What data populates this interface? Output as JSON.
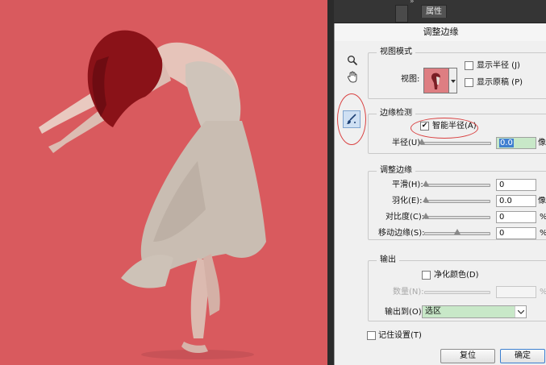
{
  "ps_panel": {
    "collapse_glyph": "»",
    "tab_label": "属性"
  },
  "dialog": {
    "title": "调整边缘",
    "tools": {
      "zoom": "zoom-icon",
      "hand": "hand-icon",
      "brush": "refine-radius-brush-icon"
    },
    "view_mode": {
      "group_title": "视图模式",
      "view_label": "视图:",
      "show_radius": {
        "label": "显示半径 (J)",
        "checked": false
      },
      "show_original": {
        "label": "显示原稿 (P)",
        "checked": false
      }
    },
    "edge_detection": {
      "group_title": "边缘检测",
      "smart_radius": {
        "label": "智能半径(A)",
        "checked": true,
        "check_glyph": "✔"
      },
      "radius": {
        "label": "半径(U):",
        "value": "0.0",
        "unit": "像",
        "slider_fraction": 0
      }
    },
    "adjust_edge": {
      "group_title": "调整边缘",
      "smooth": {
        "label": "平滑(H):",
        "value": "0",
        "unit": "",
        "slider_fraction": 0
      },
      "feather": {
        "label": "羽化(E):",
        "value": "0.0",
        "unit": "像素",
        "slider_fraction": 0
      },
      "contrast": {
        "label": "对比度(C):",
        "value": "0",
        "unit": "%",
        "slider_fraction": 0
      },
      "shift_edge": {
        "label": "移动边缘(S):",
        "value": "0",
        "unit": "%",
        "slider_fraction": 0.5
      }
    },
    "output": {
      "group_title": "输出",
      "decontaminate": {
        "label": "净化颜色(D)",
        "checked": false
      },
      "amount": {
        "label": "数量(N):",
        "value": "",
        "unit": "%",
        "disabled": true
      },
      "output_to": {
        "label": "输出到(O):",
        "selected": "选区"
      }
    },
    "remember_settings": {
      "label": "记住设置(T)",
      "checked": false
    },
    "buttons": {
      "reset": "复位",
      "ok": "确定"
    }
  },
  "colors": {
    "backdrop": "#d95a5e",
    "accent_highlight": "#c8e8c8",
    "annotation_red": "#d94040"
  }
}
